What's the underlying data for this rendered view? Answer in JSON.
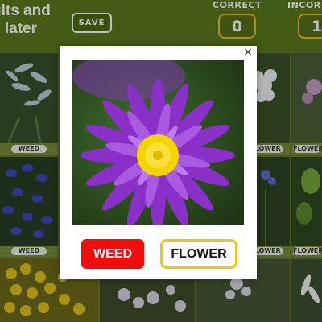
{
  "header": {
    "title": "ults and\ne later",
    "save_label": "SAVE",
    "correct_label": "CORRECT",
    "correct_value": "0",
    "incorrect_label": "INCOR",
    "incorrect_value": "1"
  },
  "tiles": [
    {
      "label": "WEED"
    },
    {
      "label": "FLOWER"
    },
    {
      "label": "FLOWER"
    },
    {
      "label": "WEED"
    },
    {
      "label": "FLOWER"
    },
    {
      "label": "FLOWER"
    }
  ],
  "modal": {
    "close_glyph": "×",
    "weed_label": "WEED",
    "flower_label": "FLOWER"
  },
  "colors": {
    "header_bg": "#5a7a1c",
    "accent_gold": "#e6be20",
    "weed_red": "#f20d0d",
    "flower_border": "#f0c419"
  }
}
